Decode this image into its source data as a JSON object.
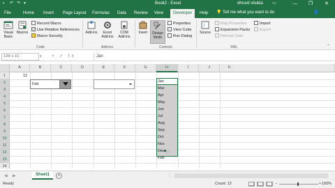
{
  "titlebar": {
    "title": "Book2  -  Excel",
    "user": "dhruvil shukla",
    "minimize": "—",
    "maximize": "❐",
    "close": "✕"
  },
  "tabs": [
    "File",
    "Home",
    "Insert",
    "Page Layout",
    "Formulas",
    "Data",
    "Review",
    "View",
    "Developer",
    "Help"
  ],
  "active_tab": "Developer",
  "tellme": "Tell me what you want to do",
  "ribbon": {
    "code": {
      "visual_basic": "Visual Basic",
      "macros": "Macros",
      "record_macro": "Record Macro",
      "use_relative": "Use Relative References",
      "macro_security": "Macro Security",
      "label": "Code"
    },
    "addins": {
      "addins": "Add-ins",
      "excel_addins": "Excel Add-ins",
      "com_addins": "COM Add-ins",
      "label": "Add-ins"
    },
    "controls": {
      "insert": "Insert",
      "design_mode": "Design Mode",
      "properties": "Properties",
      "view_code": "View Code",
      "run_dialog": "Run Dialog",
      "label": "Controls"
    },
    "xml": {
      "source": "Source",
      "map_properties": "Map Properties",
      "expansion_packs": "Expansion Packs",
      "refresh_data": "Refresh Data",
      "import": "Import",
      "export": "Export",
      "label": "XML"
    }
  },
  "formula_bar": {
    "name_box": "12R x 1C",
    "fx_icons": "× ✓ fx",
    "value": "Jan"
  },
  "columns": [
    "A",
    "B",
    "C",
    "D",
    "E",
    "F",
    "G",
    "H",
    "I",
    "J",
    "K"
  ],
  "selected_column": "H",
  "rows": [
    "1",
    "2",
    "3",
    "4",
    "5",
    "6",
    "7",
    "8",
    "9",
    "10",
    "11",
    "12",
    "13",
    "14",
    "15"
  ],
  "cell_A1": "12",
  "combo_value": "Feb",
  "months": [
    "Jan",
    "Mar",
    "Apr",
    "May",
    "Jun",
    "Jul",
    "Aug",
    "Sep",
    "Oct",
    "Nov",
    "Dec",
    "Feb"
  ],
  "sheet_tab": "Sheet1",
  "status": {
    "ready": "Ready",
    "count": "Count: 12",
    "zoom": "100%"
  },
  "colors": {
    "excel_green": "#217346"
  }
}
